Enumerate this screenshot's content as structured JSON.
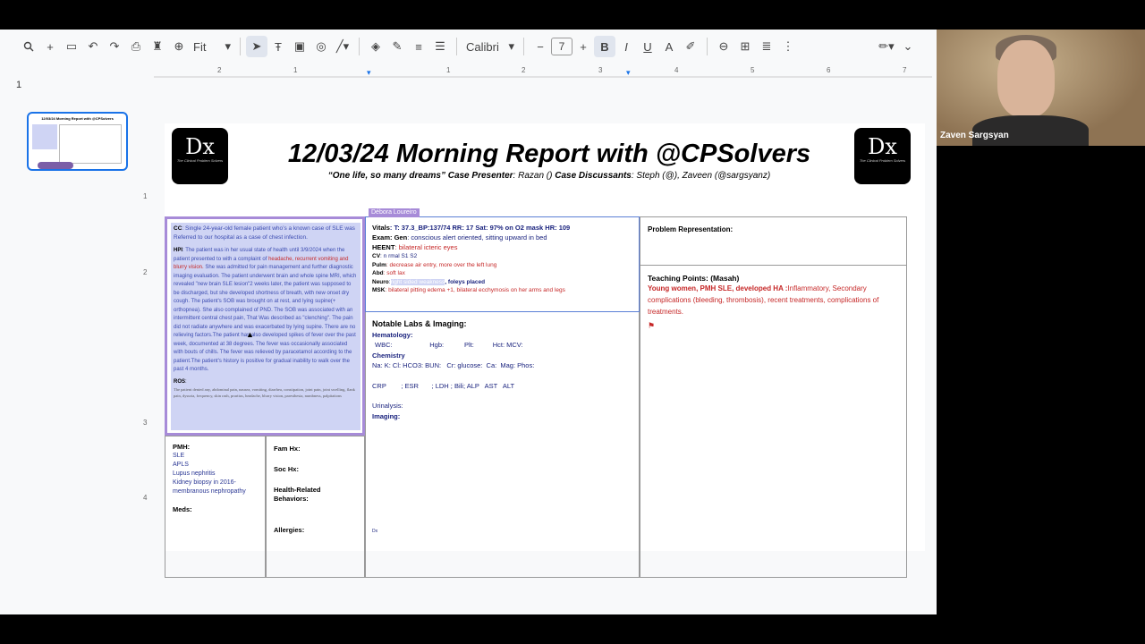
{
  "toolbar": {
    "zoom": "Fit",
    "font": "Calibri",
    "font_size": "7"
  },
  "thumb": {
    "num": "1",
    "title": "12/03/24 Morning Report with @CPSolvers"
  },
  "ruler_h": [
    "2",
    "1",
    "1",
    "2",
    "3",
    "4",
    "5",
    "6",
    "7"
  ],
  "ruler_v": [
    "1",
    "2",
    "3",
    "4"
  ],
  "slide": {
    "title": "12/03/24 Morning Report with @CPSolvers",
    "subtitle_quote": "“One life, so many dreams” Case Presenter",
    "subtitle_presenter": ": Razan  () ",
    "subtitle_disc_label": "Case Discussants",
    "subtitle_disc": ": Steph (@), Zaveen (@sargsyanz)",
    "logo_text": "Dx",
    "logo_tag": "The Clinical Problem Solvers",
    "cc_label": "CC",
    "cc_text": ": Single 24-year-old female patient who’s a known case of SLE was Referred to our hospital as a case of chest infection.",
    "hpi_label": "HPI",
    "hpi_1": ": The patient was in her usual state of health until 3/9/2024 when the patient presented to with a complaint of ",
    "hpi_red": "headache, recurrent vomiting and blurry vision.",
    "hpi_2": " She was admitted for pain management and further diagnostic imaging evaluation. The patient underwent brain and whole spine MRI, which revealed \"new brain SLE lesion\"2 weeks later, the patient was supposed to be discharged, but she developed shortness of breath, with new onset dry cough. The patient's SOB was brought on at rest, and lying supine(+ orthopnea). She also complained of PND. The SOB was associated with an intermittent central chest pain, That Was described as \"clenching\". The pain did not radiate anywhere and was exacerbated by lying supine. There are no relieving factors.The patient has also developed spikes of fever over the past week, documented at 38 degrees. The fever was occasionally associated with bouts of chills. The fever was relieved by paracetamol according to the patient.The patient's history is positive for gradual inability to walk over the past 4 months.",
    "ros_label": "ROS",
    "ros_text": "The patient denied any, abdominal pain, nausea, vomiting, diarrhea, constipation, joint pain, joint swelling, flank pain, dysuria, frequency, skin rash, pruritus, headache, blurry vision, paresthesia, numbness, palpitations",
    "collab_name": "Débora Loureiro",
    "vitals_label": "Vitals",
    "vitals": ": T: 37.3_BP:137/74  RR: 17 Sat: 97% on O2 mask HR: 109",
    "exam_label": "Exam: Gen",
    "exam_gen": ":  conscious alert oriented, sitting upward in bed",
    "heent_label": "HEENT",
    "heent": ": bilateral icteric eyes",
    "cv_label": "CV",
    "cv": ": n  rmal S1 S2",
    "pulm_label": "Pulm",
    "pulm": ": decrease air entry, more over the left lung",
    "abd_label": "Abd",
    "abd": ": soft lax",
    "neuro_label": "Neuro",
    "neuro_hl": "right sided weakness",
    "neuro": ", foleys placed",
    "msk_label": "MSK",
    "msk": ": bilateral pitting edema +1, bilateral ecchymosis on her arms and legs",
    "labs_title": "Notable Labs & Imaging",
    "hema_label": "Hematology",
    "hema_row": "WBC:                    Hgb:           Plt:          Hct: MCV:",
    "chem_label": "Chemistry",
    "chem_row": "Na: K: Cl: HCO3: BUN:   Cr: glucose:  Ca:  Mag: Phos:",
    "crp_row": "CRP        ; ESR       ; LDH ; Bili; ALP   AST   ALT",
    "ua_label": "Urinalysis",
    "img_label": "Imaging",
    "dx_mark": "Dx",
    "pr_label": "Problem Representation",
    "tp_label": "Teaching Points: (Masah)",
    "tp_red": "Young women, PMH SLE, developed HA :",
    "tp_text": "Inflammatory, Secondary complications (bleeding, thrombosis), recent treatments, complications of treatments.",
    "pmh_label": "PMH",
    "pmh_items": [
      "SLE",
      "APLS",
      "Lupus nephritis",
      "Kidney biopsy in 2016- membranous nephropathy"
    ],
    "meds_label": "Meds",
    "famhx_label": "Fam Hx",
    "sochx_label": "Soc Hx",
    "health_label": "Health-Related Behaviors",
    "allergies_label": "Allergies"
  },
  "video": {
    "name": "Zaven Sargsyan"
  },
  "colors": {
    "accent": "#1a73e8",
    "highlight": "#cfd4f4",
    "red": "#c62828",
    "navy": "#1a237e"
  }
}
